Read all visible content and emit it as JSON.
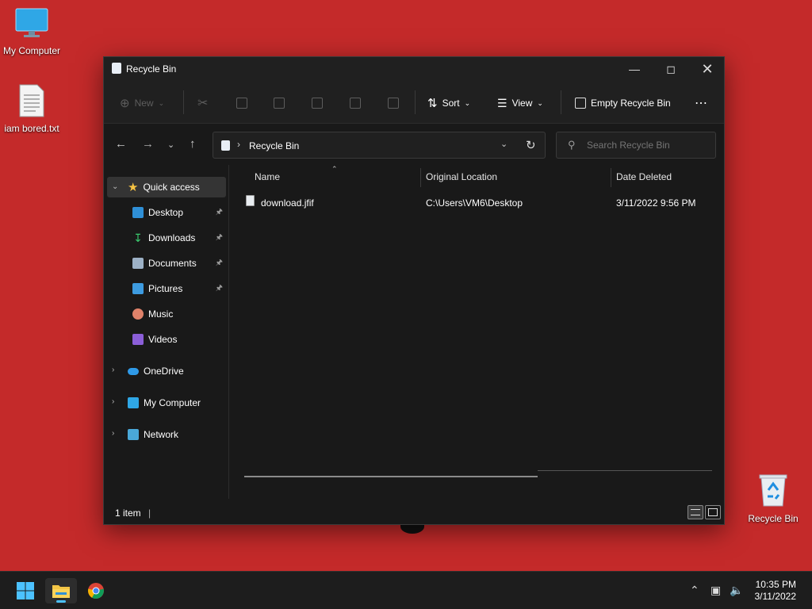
{
  "desktop": {
    "icons": [
      {
        "label": "My Computer",
        "icon": "monitor-icon"
      },
      {
        "label": "iam bored.txt",
        "icon": "text-file-icon"
      },
      {
        "label": "Recycle Bin",
        "icon": "recycle-bin-icon"
      }
    ]
  },
  "window": {
    "title": "Recycle Bin",
    "toolbar": {
      "new_label": "New",
      "sort_label": "Sort",
      "view_label": "View",
      "empty_label": "Empty Recycle Bin"
    },
    "address": {
      "path": "Recycle Bin"
    },
    "search": {
      "placeholder": "Search Recycle Bin"
    },
    "sidebar": {
      "quick_access": "Quick access",
      "pinned": [
        {
          "label": "Desktop",
          "icon": "desktop-folder-icon"
        },
        {
          "label": "Downloads",
          "icon": "downloads-folder-icon"
        },
        {
          "label": "Documents",
          "icon": "documents-folder-icon"
        },
        {
          "label": "Pictures",
          "icon": "pictures-folder-icon"
        }
      ],
      "others": [
        {
          "label": "Music",
          "icon": "music-folder-icon"
        },
        {
          "label": "Videos",
          "icon": "videos-folder-icon"
        }
      ],
      "roots": [
        {
          "label": "OneDrive",
          "icon": "onedrive-icon"
        },
        {
          "label": "My Computer",
          "icon": "computer-icon"
        },
        {
          "label": "Network",
          "icon": "network-icon"
        }
      ]
    },
    "columns": {
      "name": "Name",
      "original_location": "Original Location",
      "date_deleted": "Date Deleted"
    },
    "files": [
      {
        "name": "download.jfif",
        "original_location": "C:\\Users\\VM6\\Desktop",
        "date_deleted": "3/11/2022 9:56 PM"
      }
    ],
    "status": {
      "count": "1 item"
    }
  },
  "taskbar": {
    "time": "10:35 PM",
    "date": "3/11/2022"
  },
  "colors": {
    "accent": "#4cc2ff",
    "desktop_bg": "#c42a2a",
    "window_bg": "#191919"
  }
}
